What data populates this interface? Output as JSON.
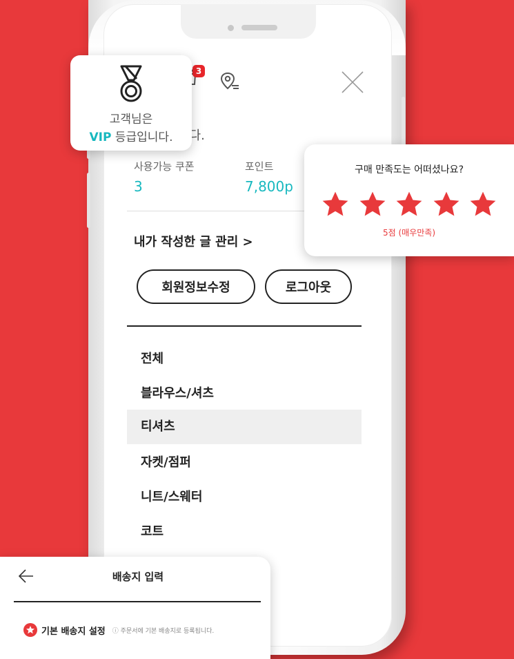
{
  "colors": {
    "background": "#e8393b",
    "accent_teal": "#17b8bf",
    "badge_red": "#e8262b",
    "star_red": "#e8393b"
  },
  "header": {
    "bag_badge_count": "3",
    "greeting_tail": "니다."
  },
  "vip_popup": {
    "line1": "고객님은",
    "grade": "VIP",
    "line2_rest": " 등급입니다."
  },
  "summary": {
    "coupon_label": "사용가능 쿠폰",
    "coupon_value": "3",
    "point_label": "포인트",
    "point_value": "7,800p"
  },
  "manage_link": "내가 작성한 글 관리 >",
  "buttons": {
    "edit_member": "회원정보수정",
    "logout": "로그아웃"
  },
  "categories": [
    {
      "label": "전체",
      "active": false
    },
    {
      "label": "블라우스/셔츠",
      "active": false
    },
    {
      "label": "티셔츠",
      "active": true
    },
    {
      "label": "자켓/점퍼",
      "active": false
    },
    {
      "label": "니트/스웨터",
      "active": false
    },
    {
      "label": "코트",
      "active": false
    }
  ],
  "rating": {
    "question": "구매 만족도는 어떠셨나요?",
    "stars": 5,
    "max_stars": 5,
    "score_text": "5점 (매우만족)"
  },
  "shipping": {
    "title": "배송지 입력",
    "default_label": "기본 배송지 설정",
    "note": "ⓘ 주문서에 기본 배송지로 등록됩니다."
  }
}
